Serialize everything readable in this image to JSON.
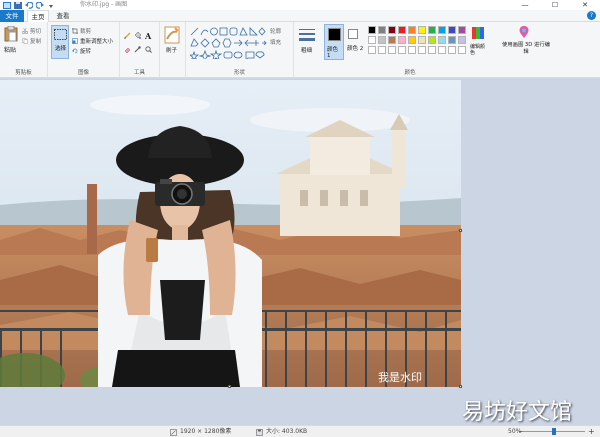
{
  "window": {
    "title": "你水印.jpg - 画图",
    "controls": {
      "minimize": "—",
      "maximize": "☐",
      "close": "✕"
    }
  },
  "tabs": {
    "file": "文件",
    "home": "主页",
    "view": "查看",
    "help": "?"
  },
  "ribbon": {
    "clipboard": {
      "paste": "粘贴",
      "cut": "剪切",
      "copy": "复制",
      "label": "剪贴板"
    },
    "image": {
      "crop": "裁剪",
      "resize": "重新调整大小",
      "rotate": "旋转",
      "select": "选择",
      "label": "图像"
    },
    "tools": {
      "label": "工具"
    },
    "brushes": {
      "label": "刷子"
    },
    "shapes": {
      "outline": "轮廓",
      "fill": "填充",
      "label": "形状"
    },
    "size": {
      "label": "粗细"
    },
    "colors": {
      "color1": "颜色 1",
      "color2": "颜色 2",
      "edit": "编辑颜色",
      "edit_paint3d": "使用画图 3D 进行编辑",
      "label": "颜色",
      "row1": [
        "#000000",
        "#7f7f7f",
        "#880015",
        "#ed1c24",
        "#ff7f27",
        "#fff200",
        "#22b14c",
        "#00a2e8",
        "#3f48cc",
        "#a349a4"
      ],
      "row2": [
        "#ffffff",
        "#c3c3c3",
        "#b97a57",
        "#ffaec9",
        "#ffc90e",
        "#efe4b0",
        "#b5e61d",
        "#99d9ea",
        "#7092be",
        "#c8bfe7"
      ],
      "row3": [
        "#ffffff",
        "#ffffff",
        "#ffffff",
        "#ffffff",
        "#ffffff",
        "#ffffff",
        "#ffffff",
        "#ffffff",
        "#ffffff",
        "#ffffff"
      ]
    }
  },
  "canvas": {
    "watermark_text": "我是水印"
  },
  "status": {
    "dimensions": "1920 × 1280像素",
    "filesize": "大小: 403.0KB",
    "zoom": "50%",
    "zoom_level": 0.5
  },
  "overlay": {
    "site_watermark": "易坊好文馆"
  }
}
